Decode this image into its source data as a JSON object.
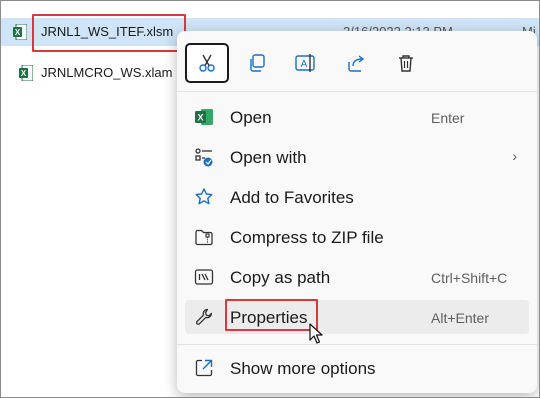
{
  "files": [
    {
      "name": "JRNL1_WS_ITEF.xlsm",
      "date": "2/16/2022 2:12 PM",
      "type": "Mi"
    },
    {
      "name": "JRNLMCRO_WS.xlam"
    }
  ],
  "toolbar": {
    "cut_icon": "scissors-icon",
    "copy_icon": "copy-icon",
    "rename_icon": "rename-icon",
    "share_icon": "share-icon",
    "delete_icon": "trash-icon"
  },
  "menu": {
    "items": [
      {
        "label": "Open",
        "shortcut": "Enter",
        "icon": "excel-icon"
      },
      {
        "label": "Open with",
        "shortcut": "›",
        "icon": "open-with-icon"
      },
      {
        "label": "Add to Favorites",
        "shortcut": "",
        "icon": "star-icon"
      },
      {
        "label": "Compress to ZIP file",
        "shortcut": "",
        "icon": "zip-folder-icon"
      },
      {
        "label": "Copy as path",
        "shortcut": "Ctrl+Shift+C",
        "icon": "path-icon"
      },
      {
        "label": "Properties",
        "shortcut": "Alt+Enter",
        "icon": "wrench-icon"
      }
    ],
    "more": {
      "label": "Show more options",
      "icon": "show-more-icon"
    }
  },
  "colors": {
    "highlight": "#d63b3b",
    "selection": "#cfe4f7",
    "excel_green": "#1e7145",
    "accent": "#1a6fc4"
  }
}
